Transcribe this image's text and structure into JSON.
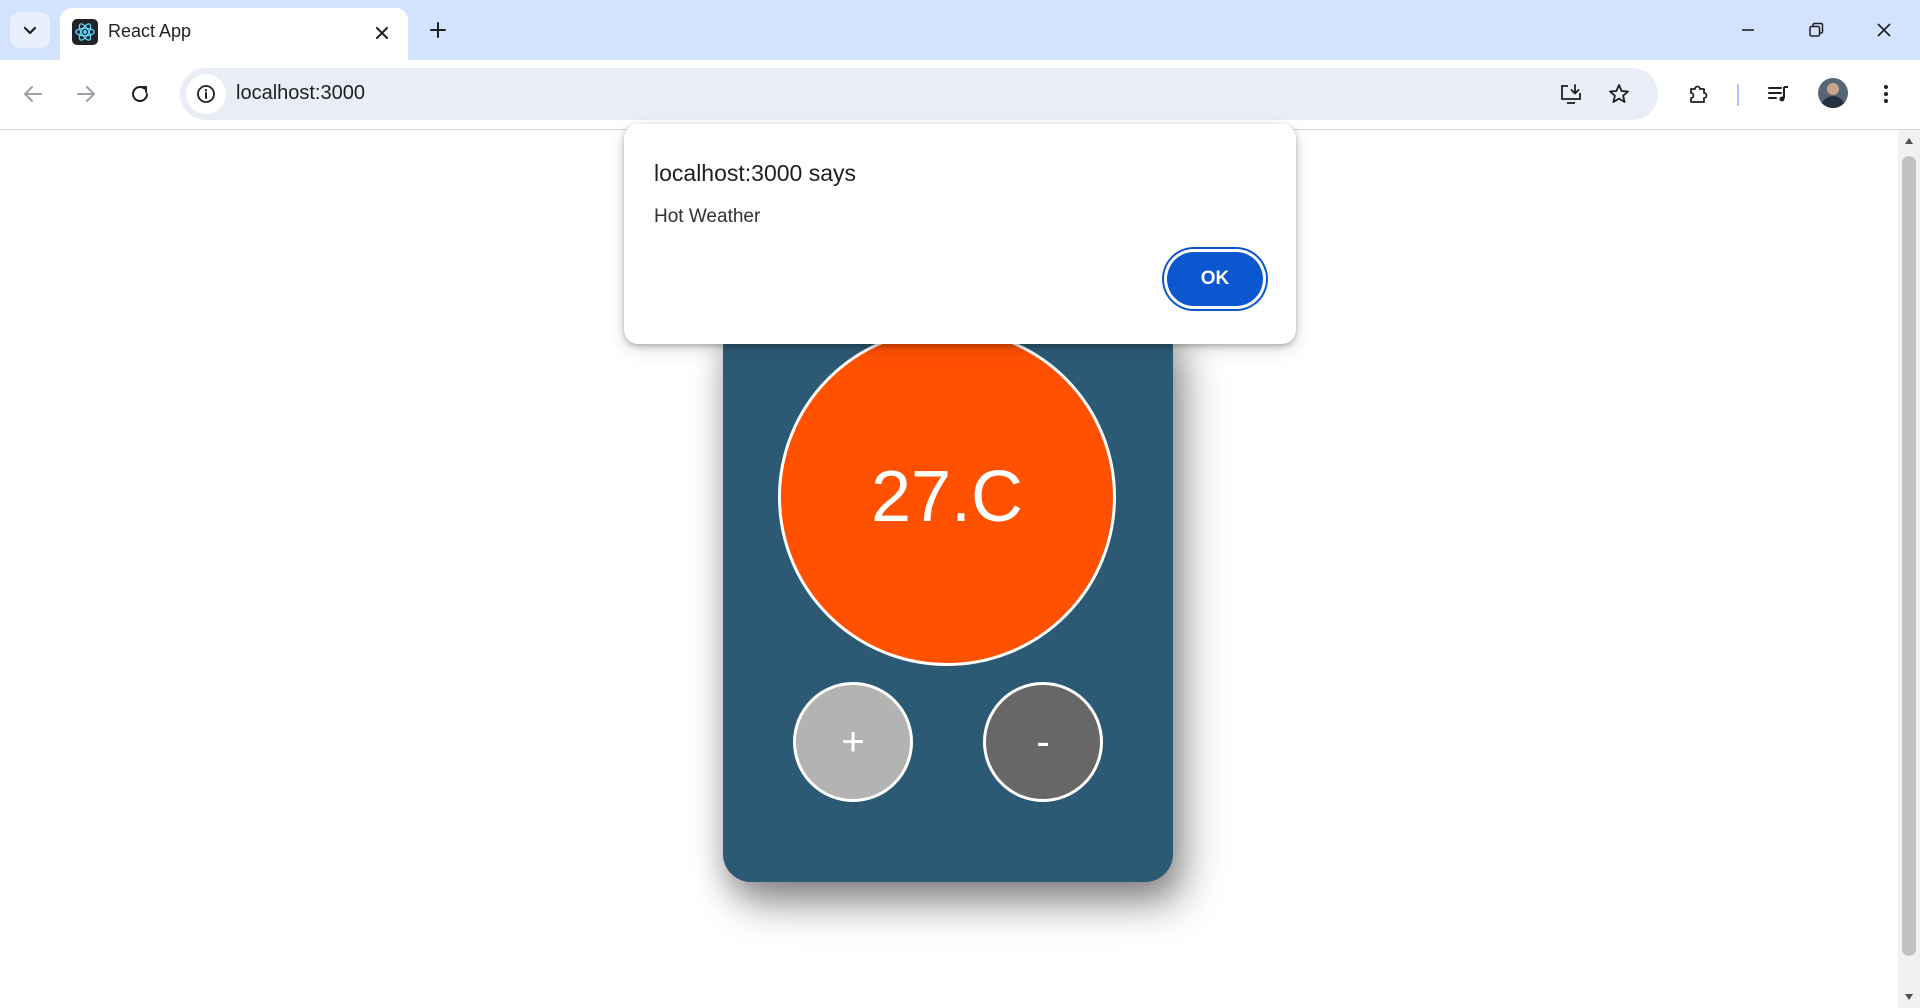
{
  "browser": {
    "tab": {
      "title": "React App"
    },
    "url": "localhost:3000"
  },
  "thermostat": {
    "temperature": "27.C",
    "increase_label": "+",
    "decrease_label": "-",
    "display_color": "#ff5100",
    "card_color": "#2c5a74"
  },
  "alert": {
    "title": "localhost:3000 says",
    "message": "Hot Weather",
    "ok_label": "OK"
  },
  "icons": {
    "tab_search": "chevron-down-icon",
    "favicon": "react-logo-icon",
    "tab_close": "close-icon",
    "new_tab": "plus-icon",
    "back": "arrow-left-icon",
    "forward": "arrow-right-icon",
    "reload": "reload-icon",
    "site_info": "info-icon",
    "install": "install-app-icon",
    "bookmark": "star-icon",
    "extensions": "puzzle-icon",
    "media": "media-control-icon",
    "menu": "kebab-menu-icon"
  }
}
